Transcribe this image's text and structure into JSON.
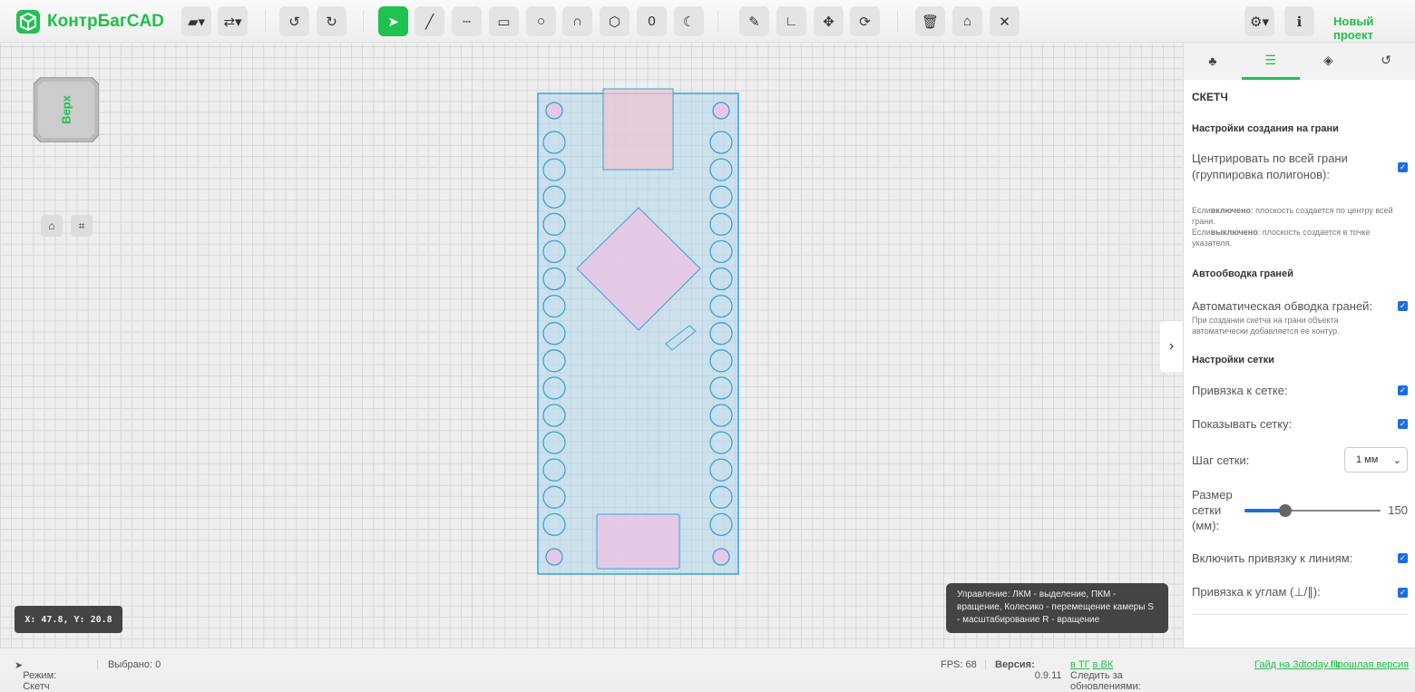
{
  "app": {
    "name": "КонтрБагCAD",
    "project": "Новый проект"
  },
  "toolbar": {
    "icons": [
      "folder-open",
      "transfer",
      "undo",
      "redo",
      "select",
      "line",
      "dashed-line",
      "rectangle",
      "circle",
      "arc",
      "polygon",
      "ellipse",
      "crescent",
      "ruler",
      "angle",
      "move",
      "rotate",
      "delete",
      "clean",
      "close",
      "settings",
      "info"
    ]
  },
  "viewcube": {
    "label": "Верх"
  },
  "panel": {
    "title": "СКЕТЧ",
    "s1": "Настройки создания на грани",
    "center_label": "Центрировать по всей грани (группировка полигонов):",
    "center_note_a1": "Если",
    "center_note_b1": "включено",
    "center_note_c1": ": плоскость создается по центру всей грани.",
    "center_note_a2": "Если",
    "center_note_b2": "выключено",
    "center_note_c2": ": плоскость создается в точке указателя.",
    "s2": "Автообводка граней",
    "auto_label": "Автоматическая обводка граней:",
    "auto_note": "При создании скетча на грани объекта автоматически добавляется ее контур.",
    "s3": "Настройки сетки",
    "snap_grid": "Привязка к сетке:",
    "show_grid": "Показывать сетку:",
    "grid_step_label": "Шаг сетки:",
    "grid_step_value": "1 мм",
    "grid_size_label": "Размер сетки (мм):",
    "grid_size_value": "150",
    "grid_size_fraction": 0.3,
    "snap_lines": "Включить привязку к линиям:",
    "snap_angles": "Привязка к углам (⊥/∥):"
  },
  "coords": "X: 47.8, Y: 20.8",
  "hint": "Управление: ЛКМ - выделение, ПКМ - вращение, Колесико - перемещение камеры S - масштабирование R - вращение",
  "status": {
    "mode": "Режим: Скетч",
    "selected": "Выбрано: 0",
    "fps": "FPS: 68",
    "version_label": "Версия:",
    "version": "0.9.11",
    "follow": "Следить за обновлениями:",
    "tg": "в ТГ",
    "vk": "в ВК",
    "guide": "Гайд на 3dtoday.ru",
    "prev": "Прошлая версия"
  },
  "colors": {
    "accent": "#1fc24f",
    "board": "#a9d3e8",
    "part": "#e8c6e6",
    "stroke": "#3aa3d4"
  }
}
